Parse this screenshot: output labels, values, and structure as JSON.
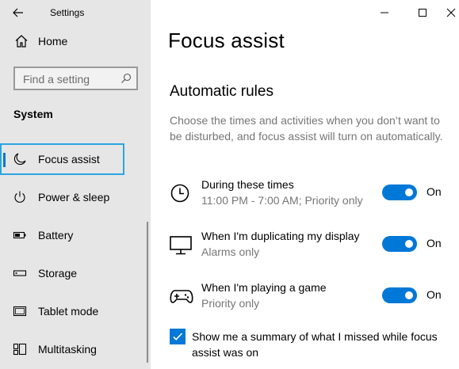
{
  "window": {
    "title": "Settings"
  },
  "sidebar": {
    "home_label": "Home",
    "search_placeholder": "Find a setting",
    "section_title": "System",
    "items": [
      {
        "label": "Focus assist",
        "icon": "moon-icon",
        "active": true
      },
      {
        "label": "Power & sleep",
        "icon": "power-icon"
      },
      {
        "label": "Battery",
        "icon": "battery-icon"
      },
      {
        "label": "Storage",
        "icon": "storage-icon"
      },
      {
        "label": "Tablet mode",
        "icon": "tablet-mode-icon"
      },
      {
        "label": "Multitasking",
        "icon": "multitasking-icon"
      }
    ]
  },
  "main": {
    "title": "Focus assist",
    "subheading": "Automatic rules",
    "description": "Choose the times and activities when you don’t want to be disturbed, and focus assist will turn on automatically.",
    "rules": [
      {
        "title": "During these times",
        "subtitle": "11:00 PM - 7:00 AM; Priority only",
        "state": "On",
        "icon": "clock-icon"
      },
      {
        "title": "When I'm duplicating my display",
        "subtitle": "Alarms only",
        "state": "On",
        "icon": "monitor-icon"
      },
      {
        "title": "When I'm playing a game",
        "subtitle": "Priority only",
        "state": "On",
        "icon": "gamepad-icon"
      }
    ],
    "summary_checkbox": {
      "label": "Show me a summary of what I missed while focus assist was on",
      "checked": true
    }
  },
  "colors": {
    "accent": "#0078d7",
    "highlight_border": "#2ba5e0",
    "sidebar_bg": "#e6e6e6",
    "secondary_text": "#767676"
  }
}
